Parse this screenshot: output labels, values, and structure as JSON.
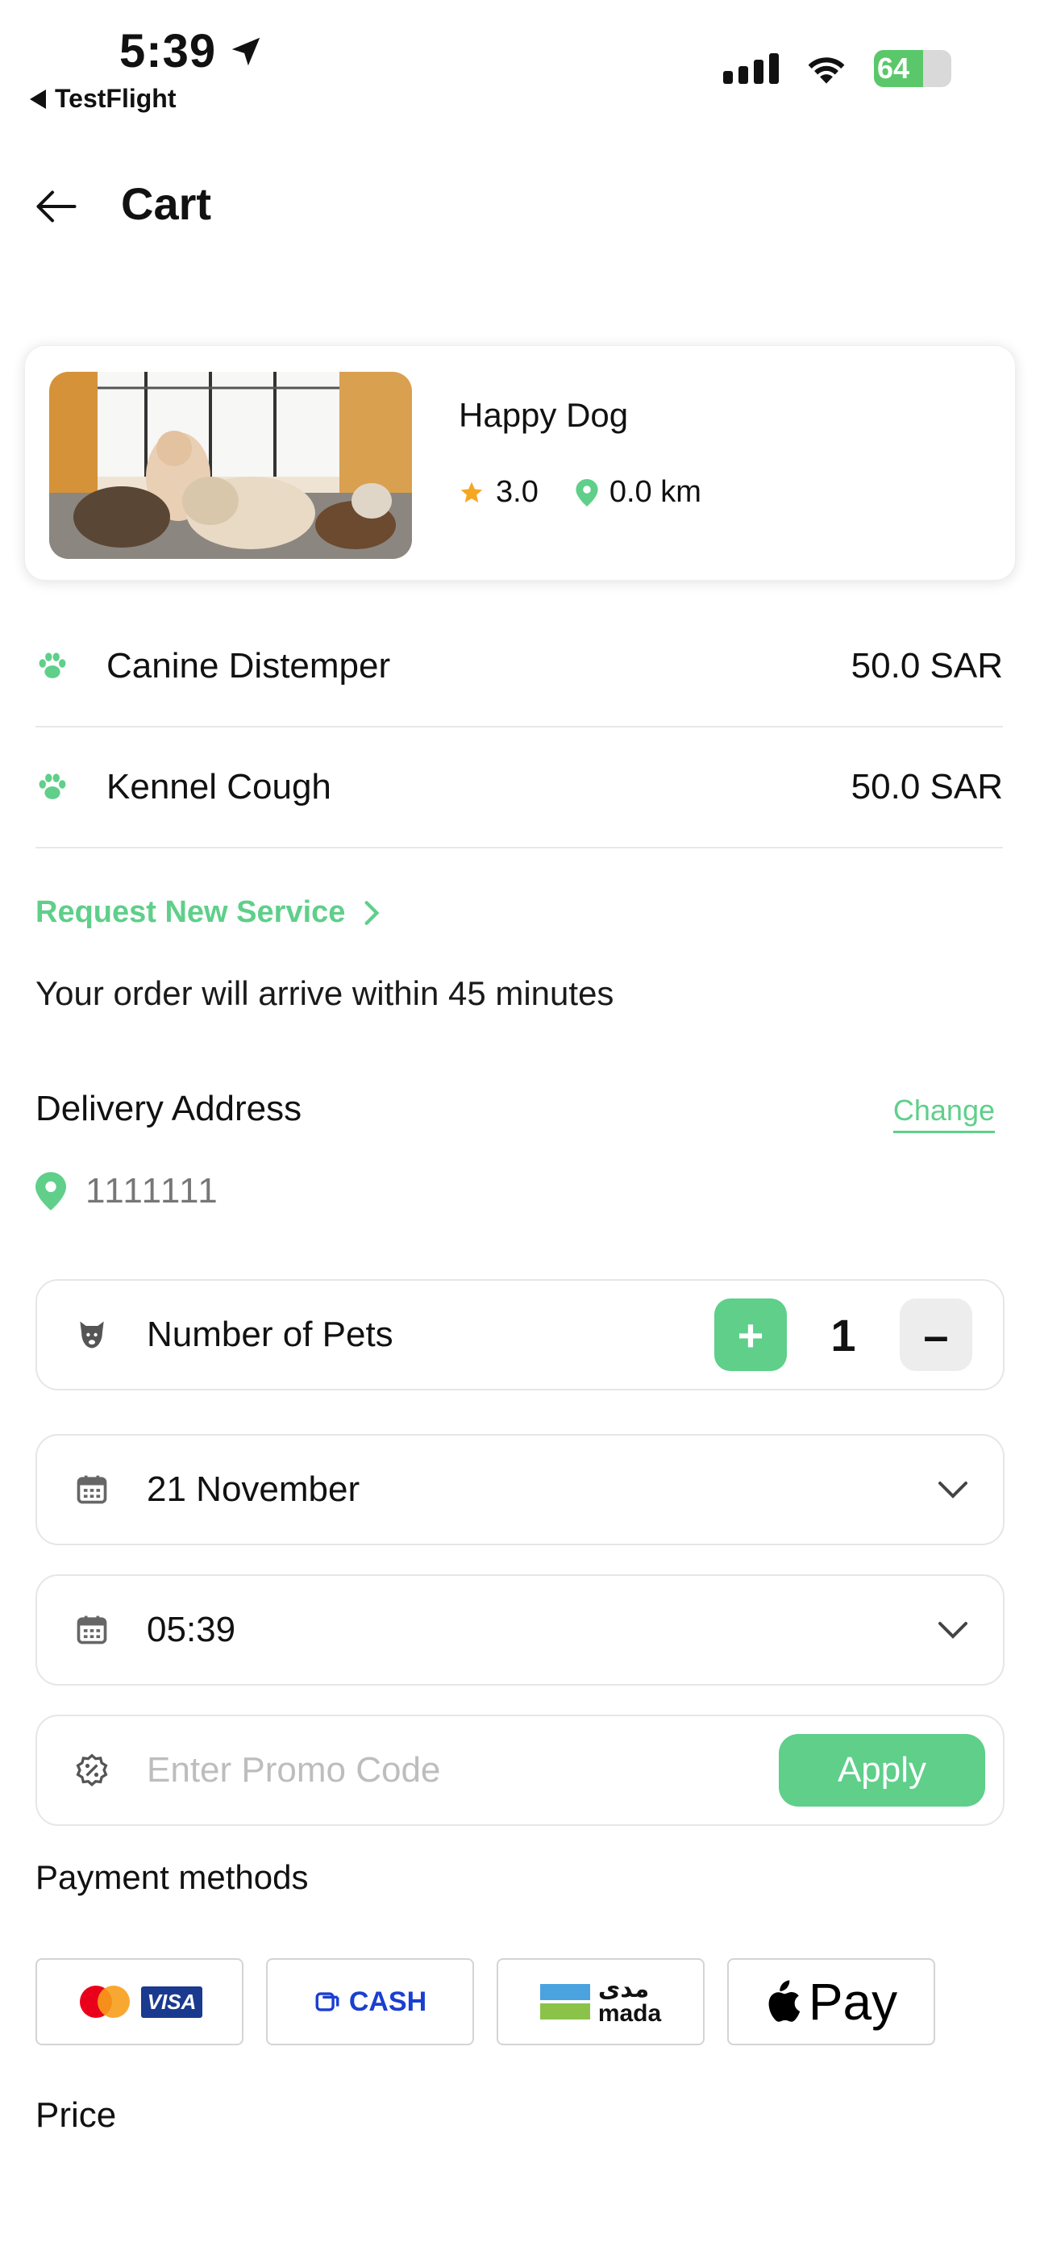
{
  "status_bar": {
    "time": "5:39",
    "back_app": "TestFlight",
    "battery": "64"
  },
  "header": {
    "title": "Cart"
  },
  "store": {
    "name": "Happy Dog",
    "rating": "3.0",
    "distance": "0.0 km"
  },
  "services": [
    {
      "name": "Canine Distemper",
      "price": "50.0 SAR"
    },
    {
      "name": "Kennel Cough",
      "price": "50.0 SAR"
    }
  ],
  "request_service": "Request New Service",
  "arrival_note": "Your order will arrive within 45 minutes",
  "delivery": {
    "label": "Delivery Address",
    "change": "Change",
    "address": "1111111"
  },
  "pets": {
    "label": "Number of Pets",
    "count": "1",
    "plus": "+",
    "minus": "–"
  },
  "date": {
    "value": "21 November"
  },
  "time_slot": {
    "value": "05:39"
  },
  "promo": {
    "placeholder": "Enter Promo Code",
    "apply": "Apply"
  },
  "payment": {
    "label": "Payment methods",
    "methods": [
      {
        "id": "card",
        "label": "VISA"
      },
      {
        "id": "cash",
        "label": "CASH"
      },
      {
        "id": "mada",
        "label": "mada",
        "label_ar": "مدى"
      },
      {
        "id": "applepay",
        "label": "Pay"
      }
    ]
  },
  "price_label": "Price",
  "colors": {
    "accent": "#5fcf8a",
    "star": "#f5a623",
    "cash_blue": "#1a3fd1"
  }
}
